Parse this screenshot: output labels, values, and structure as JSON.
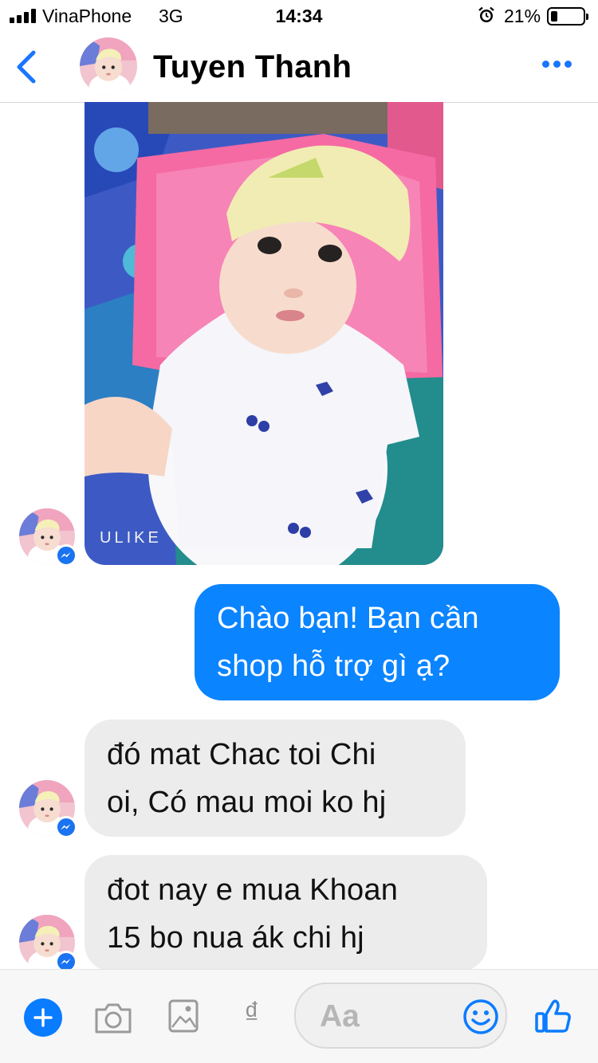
{
  "status_bar": {
    "carrier": "VinaPhone",
    "network": "3G",
    "time": "14:34",
    "battery_percent": "21%",
    "battery_level": 0.21
  },
  "header": {
    "contact_name": "Tuyen Thanh"
  },
  "conversation": {
    "photo_watermark": "ULIKE",
    "outgoing": [
      "Chào bạn! Bạn cần",
      "shop hỗ trợ gì ạ?"
    ],
    "incoming": [
      [
        "đó mat Chac toi Chi",
        "oi, Có mau moi ko hj"
      ],
      [
        "đot nay e mua Khoan",
        "15 bo nua ák chi hj"
      ]
    ]
  },
  "composer": {
    "placeholder": "Aa",
    "currency_symbol": "₫"
  },
  "colors": {
    "accent": "#0a84ff",
    "incoming_bubble": "#ececec",
    "badge": "#1a73f0"
  },
  "icons": [
    "back-chevron-icon",
    "more-icon",
    "messenger-badge-icon",
    "plus-icon",
    "camera-icon",
    "image-icon",
    "currency-icon",
    "emoji-icon",
    "thumbs-up-icon",
    "alarm-icon"
  ]
}
